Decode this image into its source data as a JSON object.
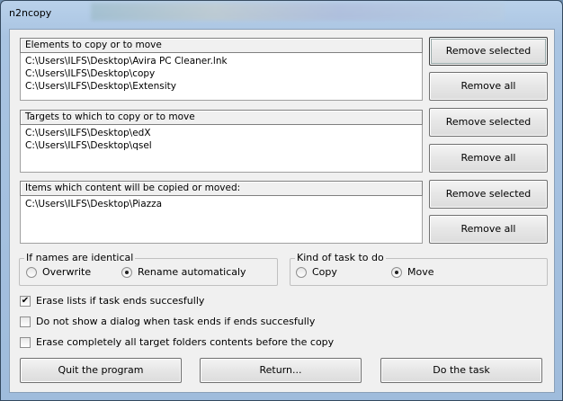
{
  "window": {
    "title": "n2ncopy"
  },
  "elements": {
    "header": "Elements to copy or to move",
    "items": [
      "C:\\Users\\ILFS\\Desktop\\Avira PC Cleaner.lnk",
      "C:\\Users\\ILFS\\Desktop\\copy",
      "C:\\Users\\ILFS\\Desktop\\Extensity"
    ]
  },
  "targets": {
    "header": "Targets to which to copy or to move",
    "items": [
      "C:\\Users\\ILFS\\Desktop\\edX",
      "C:\\Users\\ILFS\\Desktop\\qsel"
    ]
  },
  "contents": {
    "header": "Items which content will be copied or moved:",
    "items": [
      "C:\\Users\\ILFS\\Desktop\\Piazza"
    ]
  },
  "buttons": {
    "remove_selected": "Remove selected",
    "remove_all": "Remove all",
    "quit": "Quit the program",
    "return": "Return...",
    "do_task": "Do the task"
  },
  "names_group": {
    "label": "If names are identical",
    "overwrite": "Overwrite",
    "rename": "Rename automaticaly",
    "selected": "rename"
  },
  "task_group": {
    "label": "Kind of task to do",
    "copy": "Copy",
    "move": "Move",
    "selected": "move"
  },
  "options": [
    {
      "label": "Erase lists if task ends succesfully",
      "checked": true
    },
    {
      "label": "Do not show a dialog when task ends if ends succesfully",
      "checked": false
    },
    {
      "label": "Erase completely all target folders contents before the copy",
      "checked": false
    }
  ]
}
